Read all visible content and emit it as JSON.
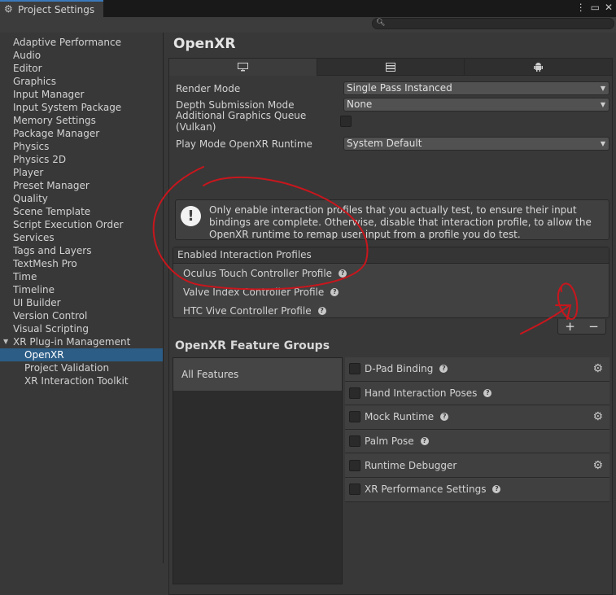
{
  "window": {
    "tab_title": "Project Settings",
    "menu_icon": "kebab-icon",
    "maximize_icon": "maximize-icon",
    "close_icon": "close-icon"
  },
  "search": {
    "placeholder": ""
  },
  "sidebar": {
    "items": [
      {
        "label": "Adaptive Performance"
      },
      {
        "label": "Audio"
      },
      {
        "label": "Editor"
      },
      {
        "label": "Graphics"
      },
      {
        "label": "Input Manager"
      },
      {
        "label": "Input System Package"
      },
      {
        "label": "Memory Settings"
      },
      {
        "label": "Package Manager"
      },
      {
        "label": "Physics"
      },
      {
        "label": "Physics 2D"
      },
      {
        "label": "Player"
      },
      {
        "label": "Preset Manager"
      },
      {
        "label": "Quality"
      },
      {
        "label": "Scene Template"
      },
      {
        "label": "Script Execution Order"
      },
      {
        "label": "Services"
      },
      {
        "label": "Tags and Layers"
      },
      {
        "label": "TextMesh Pro"
      },
      {
        "label": "Time"
      },
      {
        "label": "Timeline"
      },
      {
        "label": "UI Builder"
      },
      {
        "label": "Version Control"
      },
      {
        "label": "Visual Scripting"
      },
      {
        "label": "XR Plug-in Management"
      }
    ],
    "subitems": [
      {
        "label": "OpenXR",
        "selected": true
      },
      {
        "label": "Project Validation"
      },
      {
        "label": "XR Interaction Toolkit"
      }
    ]
  },
  "main": {
    "title": "OpenXR",
    "platform_tabs": [
      "desktop-icon",
      "server-icon",
      "android-icon"
    ],
    "render_mode": {
      "label": "Render Mode",
      "value": "Single Pass Instanced"
    },
    "depth_submission": {
      "label": "Depth Submission Mode",
      "value": "None"
    },
    "graphics_queue": {
      "label": "Additional Graphics Queue (Vulkan)",
      "checked": false
    },
    "play_mode_runtime": {
      "label": "Play Mode OpenXR Runtime",
      "value": "System Default"
    },
    "help_text": "Only enable interaction profiles that you actually test, to ensure their input bindings are complete. Otherwise, disable that interaction profile, to allow the OpenXR runtime to remap user input from a profile you do test.",
    "profiles": {
      "header": "Enabled Interaction Profiles",
      "items": [
        "Oculus Touch Controller Profile",
        "Valve Index Controller Profile",
        "HTC Vive Controller Profile"
      ],
      "add_label": "+",
      "remove_label": "−"
    },
    "feature_groups": {
      "title": "OpenXR Feature Groups",
      "all_label": "All Features",
      "features": [
        {
          "label": "D-Pad Binding",
          "settings": true
        },
        {
          "label": "Hand Interaction Poses",
          "settings": false
        },
        {
          "label": "Mock Runtime",
          "settings": true
        },
        {
          "label": "Palm Pose",
          "settings": false
        },
        {
          "label": "Runtime Debugger",
          "settings": true
        },
        {
          "label": "XR Performance Settings",
          "settings": false
        }
      ]
    }
  },
  "annotation_color": "#c8161d"
}
